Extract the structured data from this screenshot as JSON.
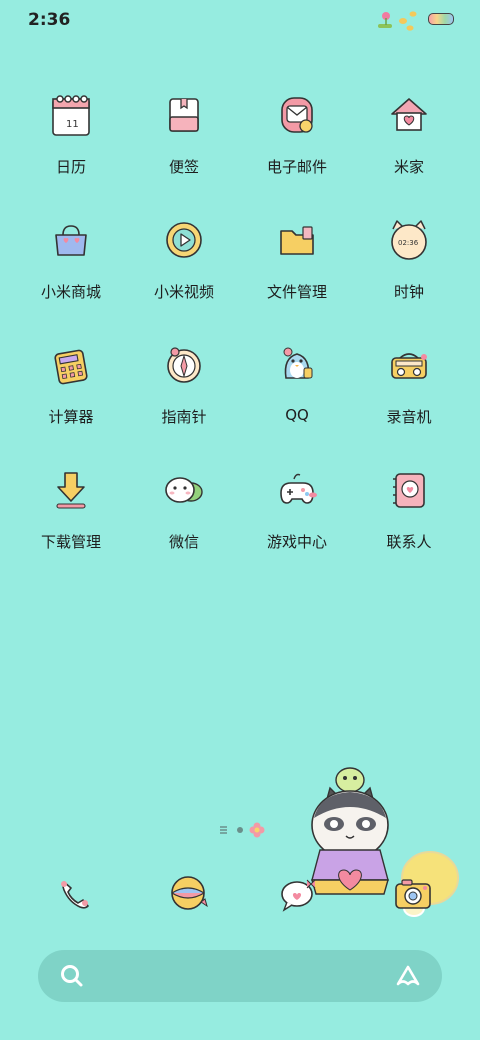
{
  "status_bar": {
    "time": "2:36"
  },
  "apps": [
    {
      "label": "日历",
      "icon": "calendar-icon",
      "badge": "11"
    },
    {
      "label": "便签",
      "icon": "notes-icon"
    },
    {
      "label": "电子邮件",
      "icon": "email-icon"
    },
    {
      "label": "米家",
      "icon": "home-icon"
    },
    {
      "label": "小米商城",
      "icon": "shopping-bag-icon"
    },
    {
      "label": "小米视频",
      "icon": "video-play-icon"
    },
    {
      "label": "文件管理",
      "icon": "folder-icon"
    },
    {
      "label": "时钟",
      "icon": "clock-icon",
      "badge": "02:36"
    },
    {
      "label": "计算器",
      "icon": "calculator-icon"
    },
    {
      "label": "指南针",
      "icon": "compass-icon"
    },
    {
      "label": "QQ",
      "icon": "penguin-icon"
    },
    {
      "label": "录音机",
      "icon": "recorder-icon"
    },
    {
      "label": "下载管理",
      "icon": "download-icon"
    },
    {
      "label": "微信",
      "icon": "chat-bubbles-icon"
    },
    {
      "label": "游戏中心",
      "icon": "gamepad-icon"
    },
    {
      "label": "联系人",
      "icon": "contacts-book-icon"
    }
  ],
  "dock": [
    {
      "icon": "phone-icon"
    },
    {
      "icon": "browser-ball-icon"
    },
    {
      "icon": "message-icon"
    },
    {
      "icon": "camera-icon"
    }
  ],
  "colors": {
    "background": "#96ece0",
    "search_bar": "#7fd3c7"
  }
}
